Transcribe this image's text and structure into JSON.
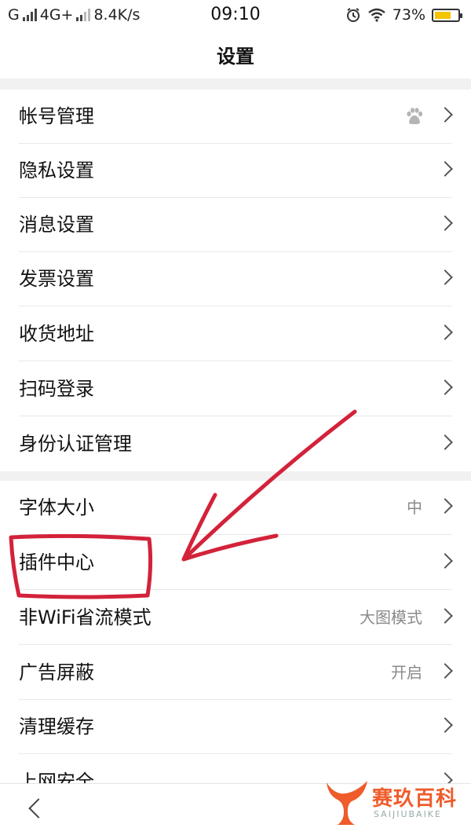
{
  "status_bar": {
    "carrier": "G",
    "network": "4G+",
    "speed": "8.4K/s",
    "time": "09:10",
    "battery": "73%",
    "battery_level": 0.73
  },
  "header": {
    "title": "设置"
  },
  "sections": [
    {
      "items": [
        {
          "label": "帐号管理",
          "value": "",
          "icon": "baidu-paw-icon"
        },
        {
          "label": "隐私设置",
          "value": ""
        },
        {
          "label": "消息设置",
          "value": ""
        },
        {
          "label": "发票设置",
          "value": ""
        },
        {
          "label": "收货地址",
          "value": ""
        },
        {
          "label": "扫码登录",
          "value": ""
        },
        {
          "label": "身份认证管理",
          "value": ""
        }
      ]
    },
    {
      "items": [
        {
          "label": "字体大小",
          "value": "中"
        },
        {
          "label": "插件中心",
          "value": ""
        },
        {
          "label": "非WiFi省流模式",
          "value": "大图模式"
        },
        {
          "label": "广告屏蔽",
          "value": "开启"
        },
        {
          "label": "清理缓存",
          "value": ""
        },
        {
          "label": "上网安全",
          "value": ""
        }
      ]
    }
  ],
  "bottom_bar": {
    "back_icon": "back-arrow-icon"
  },
  "watermark": {
    "brand": "赛玖百科",
    "brand_latin": "SAIJIUBAIKE"
  },
  "colors": {
    "annotation": "#d3223a",
    "watermark": "#ef5b2a",
    "section_gap": "#f1f1f1"
  }
}
